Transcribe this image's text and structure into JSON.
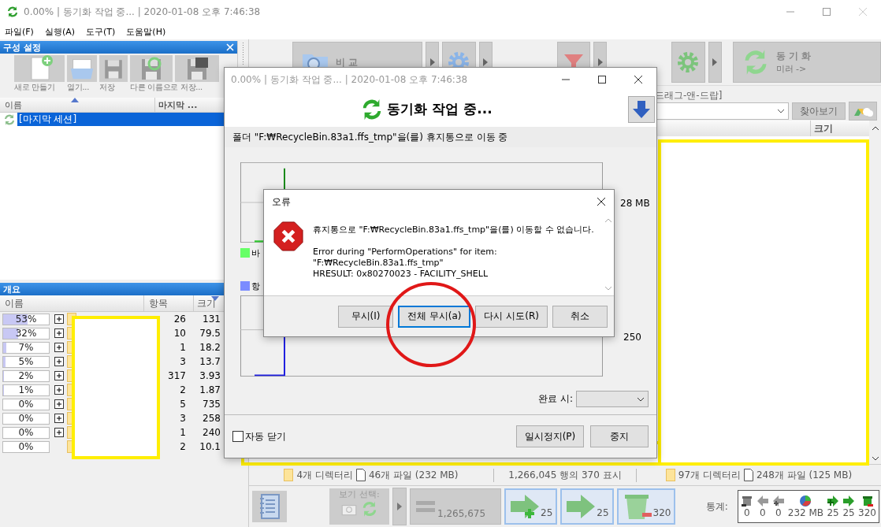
{
  "window": {
    "title": "0.00% | 동기화 작업 중... | 2020-01-08 오후 7:46:38"
  },
  "menu": [
    "파일(F)",
    "실행(A)",
    "도구(T)",
    "도움말(H)"
  ],
  "config_panel": {
    "title": "구성 설정",
    "toolbar": [
      {
        "kind": "new",
        "label": "새로 만들기"
      },
      {
        "kind": "open",
        "label": "열기..."
      },
      {
        "kind": "save",
        "label": "저장"
      },
      {
        "kind": "save-as",
        "label": "다른 이름으로 저장..."
      },
      {
        "kind": "save-batch"
      }
    ],
    "columns": [
      "이름",
      "마지막 ..."
    ],
    "items": [
      {
        "label": "[마지막 세션]",
        "selected": true
      }
    ]
  },
  "overview_panel": {
    "title": "개요",
    "columns": [
      "이름",
      "항목",
      "크기"
    ],
    "rows": [
      {
        "percent": "53%",
        "level": 0.53,
        "expandable": true,
        "count": "26",
        "size": "131"
      },
      {
        "percent": "32%",
        "level": 0.32,
        "expandable": true,
        "count": "10",
        "size": "79.5"
      },
      {
        "percent": "7%",
        "level": 0.07,
        "expandable": true,
        "count": "1",
        "size": "18.2"
      },
      {
        "percent": "5%",
        "level": 0.05,
        "expandable": true,
        "count": "3",
        "size": "13.7"
      },
      {
        "percent": "2%",
        "level": 0.02,
        "expandable": true,
        "count": "317",
        "size": "3.93"
      },
      {
        "percent": "1%",
        "level": 0.01,
        "expandable": true,
        "count": "2",
        "size": "1.87"
      },
      {
        "percent": "0%",
        "level": 0,
        "expandable": true,
        "count": "5",
        "size": "735"
      },
      {
        "percent": "0%",
        "level": 0,
        "expandable": true,
        "count": "3",
        "size": "258"
      },
      {
        "percent": "0%",
        "level": 0,
        "expandable": true,
        "count": "1",
        "size": "240"
      },
      {
        "percent": "0%",
        "level": 0,
        "expandable": false,
        "count": "2",
        "size": "10.1"
      }
    ]
  },
  "toolbar": {
    "compare": "비 교",
    "sync": "동 기 화",
    "sync_variant": "미러 ->"
  },
  "folder_bar": {
    "label": "드래그-앤-드랍]",
    "browse": "찾아보기"
  },
  "grid": {
    "columns": [
      "크기"
    ]
  },
  "status_bar": {
    "left_dirs": "4개 디렉터리",
    "left_files": "46개 파일 (232 MB)",
    "center": "1,266,045 행의 370 표시",
    "right_dirs": "97개 디렉터리",
    "right_files": "248개 파일 (125 MB)"
  },
  "bottom_toolbar": {
    "view_label": "보기 선택:",
    "buttons": [
      {
        "kind": "equal",
        "count": "1,265,675",
        "selected": false
      },
      {
        "kind": "create",
        "count": "25",
        "selected": true
      },
      {
        "kind": "update",
        "count": "25",
        "selected": true
      },
      {
        "kind": "delete",
        "count": "320",
        "selected": true
      }
    ],
    "stats_label": "통계:",
    "stats": [
      {
        "kind": "delete-left",
        "value": "0"
      },
      {
        "kind": "update-left",
        "value": "0"
      },
      {
        "kind": "create-left",
        "value": "0"
      },
      {
        "kind": "data",
        "value": "232 MB"
      },
      {
        "kind": "create-right",
        "value": "25"
      },
      {
        "kind": "update-right",
        "value": "25"
      },
      {
        "kind": "delete-right",
        "value": "320"
      }
    ]
  },
  "progress_dialog": {
    "title": "0.00% | 동기화 작업 중... | 2020-01-08 오후 7:46:38",
    "heading": "동기화 작업 중...",
    "status": "폴더 \"F:₩RecycleBin.83a1.ffs_tmp\"을(를) 휴지통으로 이동 중",
    "legend": [
      {
        "label": "바",
        "color": "#66ff66"
      },
      {
        "label": "항",
        "color": "#7b8cff"
      }
    ],
    "axis_labels": [
      "28 MB",
      "250"
    ],
    "completion_label": "완료 시:",
    "auto_close": {
      "label": "자동 닫기",
      "checked": false
    },
    "buttons": [
      "일시정지(P)",
      "중지"
    ]
  },
  "error_dialog": {
    "title": "오류",
    "message": "휴지통으로 \"F:₩RecycleBin.83a1.ffs_tmp\"을(를) 이동할 수 없습니다.",
    "details": [
      "Error during \"PerformOperations\" for item:",
      "\"F:₩RecycleBin.83a1.ffs_tmp\"",
      "HRESULT: 0x80270023 - FACILITY_SHELL"
    ],
    "buttons": [
      {
        "label": "무시(I)",
        "selected": false
      },
      {
        "label": "전체 무시(a)",
        "selected": true
      },
      {
        "label": "다시 시도(R)",
        "selected": false
      },
      {
        "label": "취소",
        "selected": false
      }
    ]
  }
}
